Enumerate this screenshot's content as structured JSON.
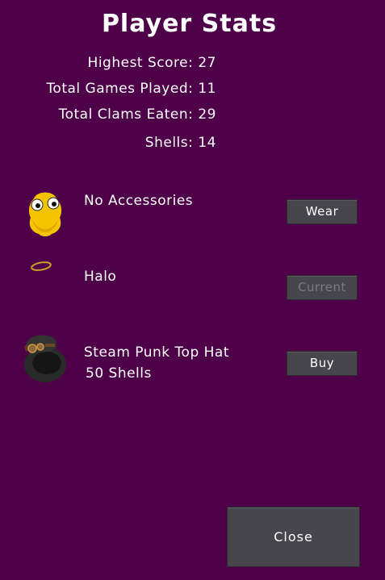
{
  "title": "Player Stats",
  "stats": [
    {
      "label": "Highest Score:",
      "value": "27"
    },
    {
      "label": "Total Games Played:",
      "value": "11"
    },
    {
      "label": "Total Clams Eaten:",
      "value": "29"
    },
    {
      "label": "Shells:",
      "value": "14"
    }
  ],
  "accessories": [
    {
      "name": "No Accessories",
      "cost": "",
      "button": "Wear",
      "icon": "yellow-creature-icon",
      "button_enabled": true
    },
    {
      "name": "Halo",
      "cost": "",
      "button": "Current",
      "icon": "halo-icon",
      "button_enabled": false
    },
    {
      "name": "Steam Punk Top Hat",
      "cost": "50 Shells",
      "button": "Buy",
      "icon": "steampunk-top-hat-icon",
      "button_enabled": true
    }
  ],
  "close_label": "Close",
  "colors": {
    "background": "#4e0049",
    "button": "#46464c",
    "button_text": "#ffffff",
    "disabled_text": "#7a7a7e"
  }
}
